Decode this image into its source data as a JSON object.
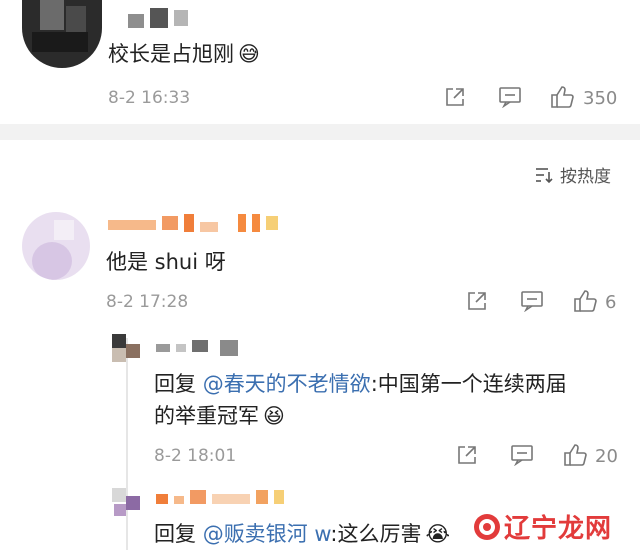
{
  "post": {
    "text": "校长是占旭刚",
    "emoji": "😅",
    "time": "8-2 16:33",
    "likes": "350"
  },
  "sort": {
    "label": "按热度"
  },
  "comment": {
    "text": "他是 shui 呀",
    "time": "8-2 17:28",
    "likes": "6"
  },
  "replies": [
    {
      "prefix": "回复 ",
      "mention": "@春天的不老情欲",
      "text_line1": ":中国第一个连续两届",
      "text_line2": "的举重冠军",
      "emoji": "😆",
      "time": "8-2 18:01",
      "likes": "20"
    },
    {
      "prefix": "回复 ",
      "mention": "@贩卖银河 w",
      "text_line1": ":这么厉害",
      "emoji": "😭"
    }
  ],
  "watermark": {
    "text": "辽宁龙网"
  }
}
